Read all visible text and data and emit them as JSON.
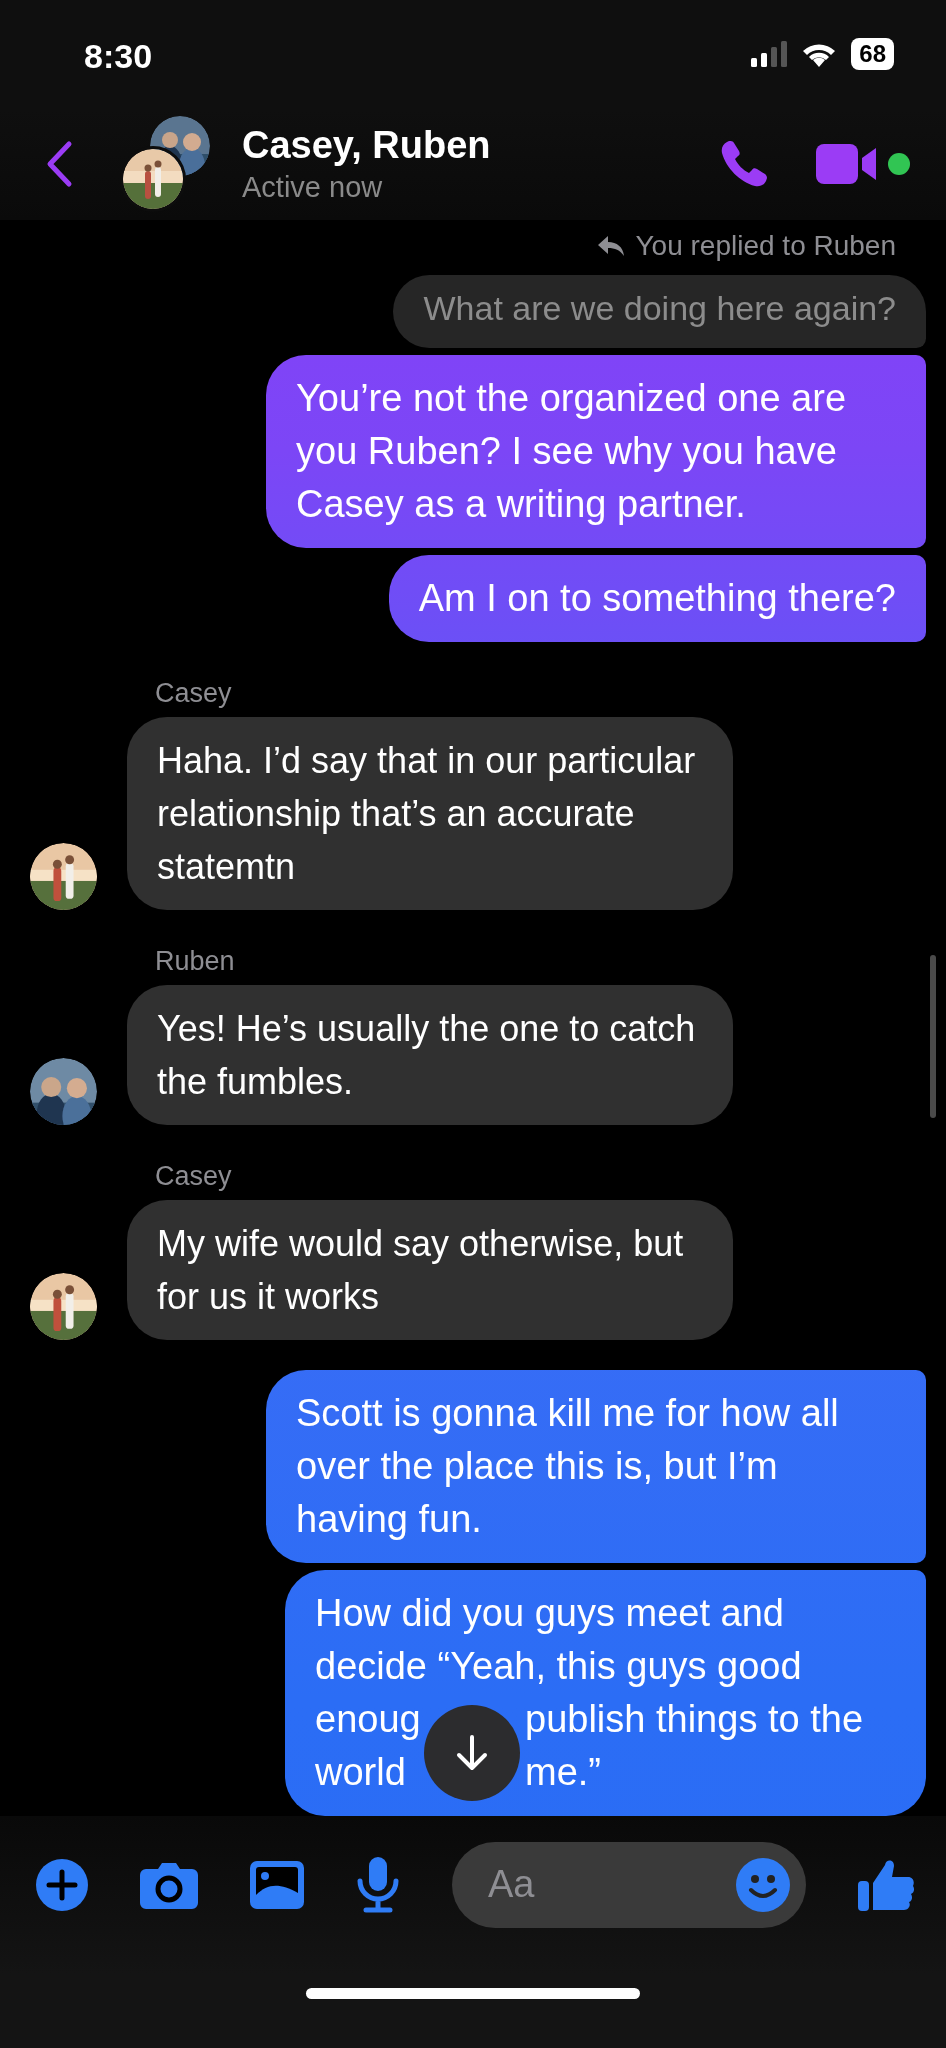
{
  "status_bar": {
    "time": "8:30",
    "battery": "68"
  },
  "header": {
    "title": "Casey, Ruben",
    "subtitle": "Active now",
    "online": true
  },
  "messages": [
    {
      "kind": "reply_note",
      "text": "You replied to Ruben"
    },
    {
      "kind": "reply_quote",
      "text": "What are we doing here again?"
    },
    {
      "kind": "outgoing",
      "text": "You’re not the organized one are you Ruben? I see why you have Casey as a writing partner."
    },
    {
      "kind": "outgoing",
      "text": "Am I on to something there?"
    },
    {
      "kind": "incoming",
      "sender": "Casey",
      "text": "Haha. I’d say that in our particular relationship that’s an accurate statemtn"
    },
    {
      "kind": "incoming",
      "sender": "Ruben",
      "text": "Yes! He’s usually the one to catch the fumbles."
    },
    {
      "kind": "incoming",
      "sender": "Casey",
      "text": "My wife would say otherwise, but for us it works"
    },
    {
      "kind": "outgoing",
      "text": "Scott is gonna kill me for how all over the place this is, but I’m having fun."
    },
    {
      "kind": "outgoing_covered",
      "lines": [
        [
          "How did you guys meet and"
        ],
        [
          "decide “Yeah, this guys good"
        ],
        [
          "enoug",
          "publish things to the"
        ],
        [
          "world",
          "me.”"
        ]
      ]
    }
  ],
  "composer": {
    "placeholder": "Aa"
  }
}
